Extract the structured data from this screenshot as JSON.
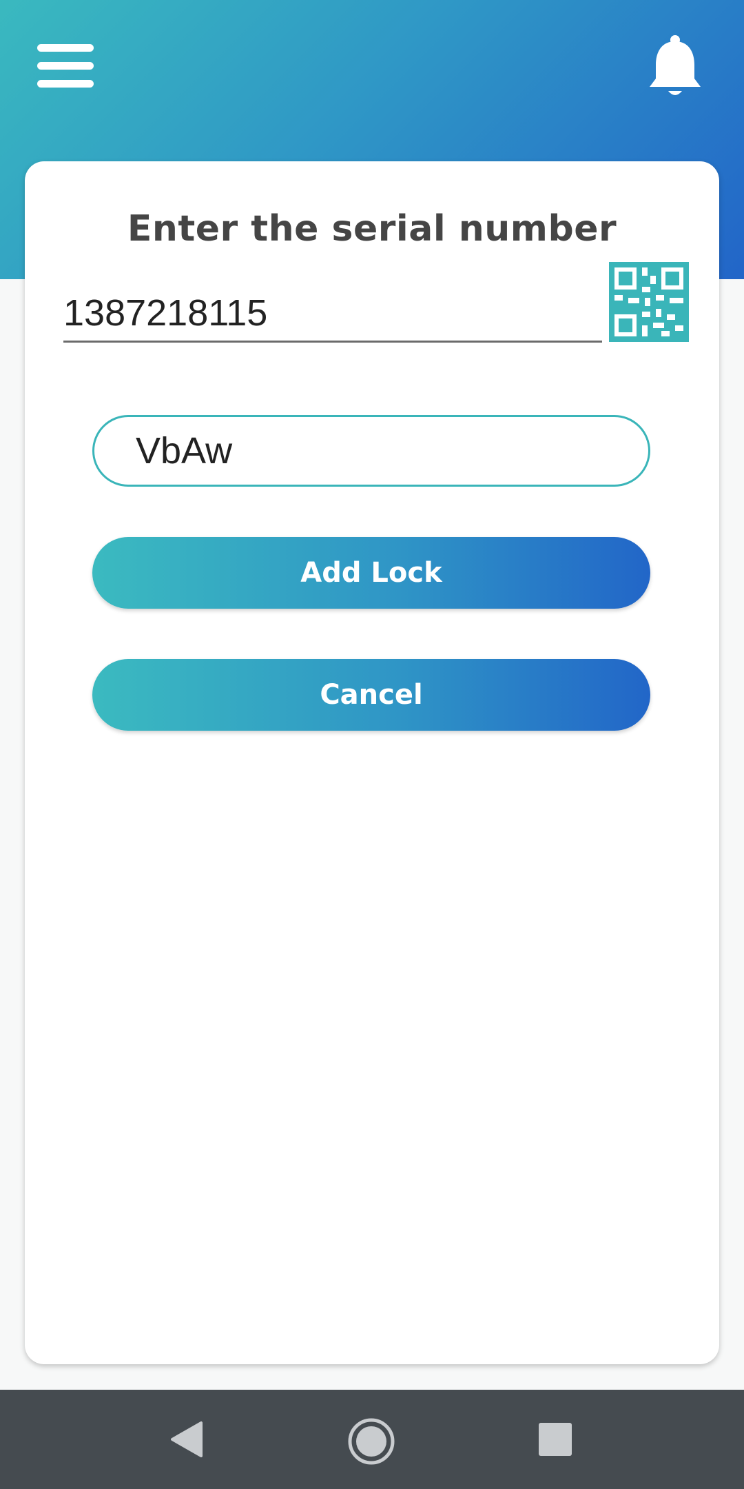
{
  "header": {
    "menu_icon": "hamburger-menu-icon",
    "notification_icon": "bell-icon",
    "gradient_colors": [
      "#3ab9bf",
      "#2265c8"
    ]
  },
  "card": {
    "title": "Enter the serial number",
    "serial_value": "1387218115",
    "qr_icon": "qr-code-icon",
    "code_value": "VbAw",
    "add_button_label": "Add Lock",
    "cancel_button_label": "Cancel",
    "accent_color": "#3ab5b9"
  },
  "navbar": {
    "back_icon": "back-triangle-icon",
    "home_icon": "home-circle-icon",
    "recents_icon": "recents-square-icon"
  }
}
